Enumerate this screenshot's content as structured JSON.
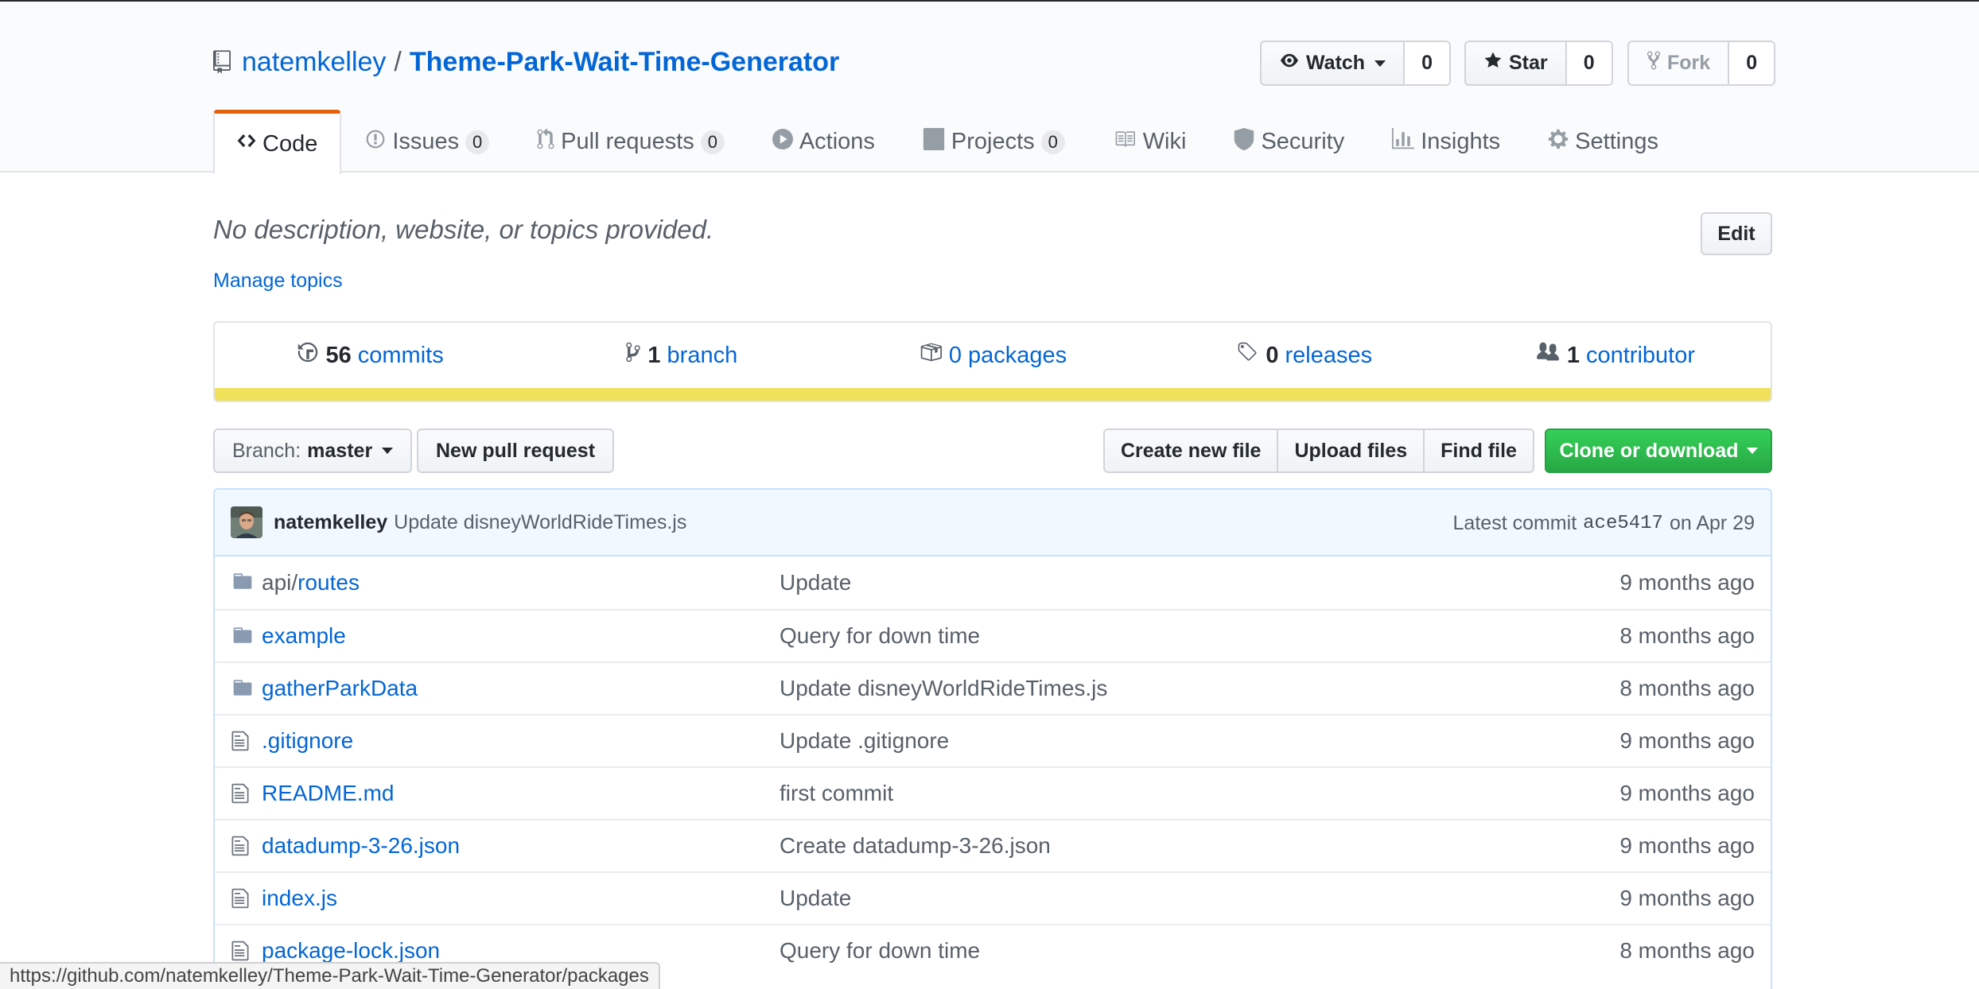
{
  "repo": {
    "owner": "natemkelley",
    "separator": "/",
    "name": "Theme-Park-Wait-Time-Generator"
  },
  "actions": {
    "watch_label": "Watch",
    "watch_count": "0",
    "star_label": "Star",
    "star_count": "0",
    "fork_label": "Fork",
    "fork_count": "0"
  },
  "nav": {
    "code": "Code",
    "issues": "Issues",
    "issues_count": "0",
    "pulls": "Pull requests",
    "pulls_count": "0",
    "actions": "Actions",
    "projects": "Projects",
    "projects_count": "0",
    "wiki": "Wiki",
    "security": "Security",
    "insights": "Insights",
    "settings": "Settings"
  },
  "meta": {
    "description": "No description, website, or topics provided.",
    "manage_topics": "Manage topics",
    "edit_label": "Edit"
  },
  "summary": {
    "commits_num": "56",
    "commits_label": "commits",
    "branch_num": "1",
    "branch_label": "branch",
    "packages_label": "0 packages",
    "releases_num": "0",
    "releases_label": "releases",
    "contributors_num": "1",
    "contributors_label": "contributor",
    "language_color": "#f1e05a"
  },
  "file_nav": {
    "branch_prefix": "Branch:",
    "branch_name": "master",
    "new_pr": "New pull request",
    "create_file": "Create new file",
    "upload_files": "Upload files",
    "find_file": "Find file",
    "clone": "Clone or download"
  },
  "latest_commit": {
    "author": "natemkelley",
    "message": "Update disneyWorldRideTimes.js",
    "prefix": "Latest commit",
    "sha": "ace5417",
    "date": "on Apr 29"
  },
  "files": [
    {
      "dir_prefix": "api/",
      "name": "routes",
      "message": "Update",
      "age": "9 months ago",
      "type": "folder"
    },
    {
      "dir_prefix": "",
      "name": "example",
      "message": "Query for down time",
      "age": "8 months ago",
      "type": "folder"
    },
    {
      "dir_prefix": "",
      "name": "gatherParkData",
      "message": "Update disneyWorldRideTimes.js",
      "age": "8 months ago",
      "type": "folder"
    },
    {
      "dir_prefix": "",
      "name": ".gitignore",
      "message": "Update .gitignore",
      "age": "9 months ago",
      "type": "file"
    },
    {
      "dir_prefix": "",
      "name": "README.md",
      "message": "first commit",
      "age": "9 months ago",
      "type": "file"
    },
    {
      "dir_prefix": "",
      "name": "datadump-3-26.json",
      "message": "Create datadump-3-26.json",
      "age": "9 months ago",
      "type": "file"
    },
    {
      "dir_prefix": "",
      "name": "index.js",
      "message": "Update",
      "age": "9 months ago",
      "type": "file"
    },
    {
      "dir_prefix": "",
      "name": "package-lock.json",
      "message": "Query for down time",
      "age": "8 months ago",
      "type": "file"
    }
  ],
  "status_url": "https://github.com/natemkelley/Theme-Park-Wait-Time-Generator/packages"
}
